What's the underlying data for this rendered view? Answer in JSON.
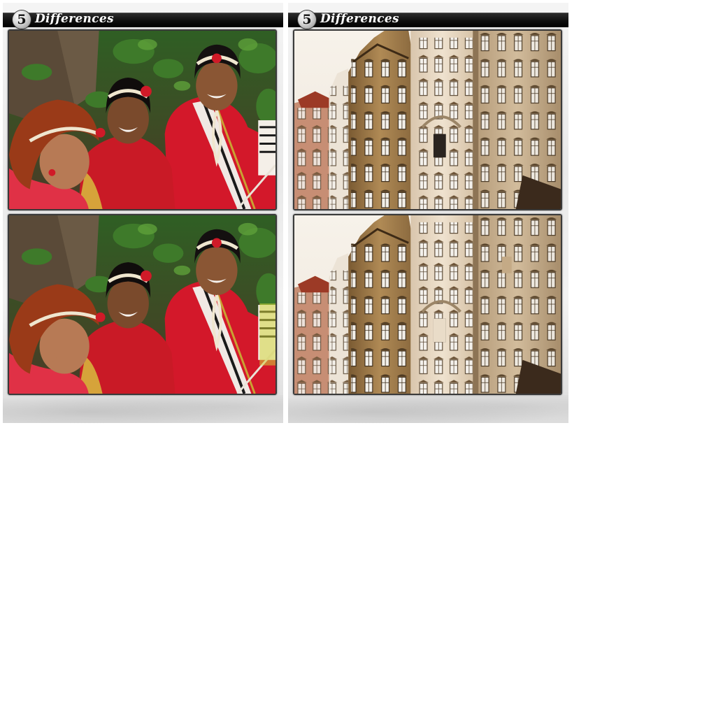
{
  "puzzles": [
    {
      "badge_number": "5",
      "title": "Differences",
      "scene": "women-in-red-saris",
      "images": [
        "original",
        "modified"
      ]
    },
    {
      "badge_number": "5",
      "title": "Differences",
      "scene": "old-town-facades",
      "images": [
        "original",
        "modified"
      ]
    }
  ],
  "colors": {
    "title_bar": "#000000",
    "panel_bg": "#ececec",
    "frame": "#3a3a3a",
    "sari_red": "#d3182a",
    "facade_ochre": "#a9824d",
    "facade_cream": "#e8d8c3"
  }
}
